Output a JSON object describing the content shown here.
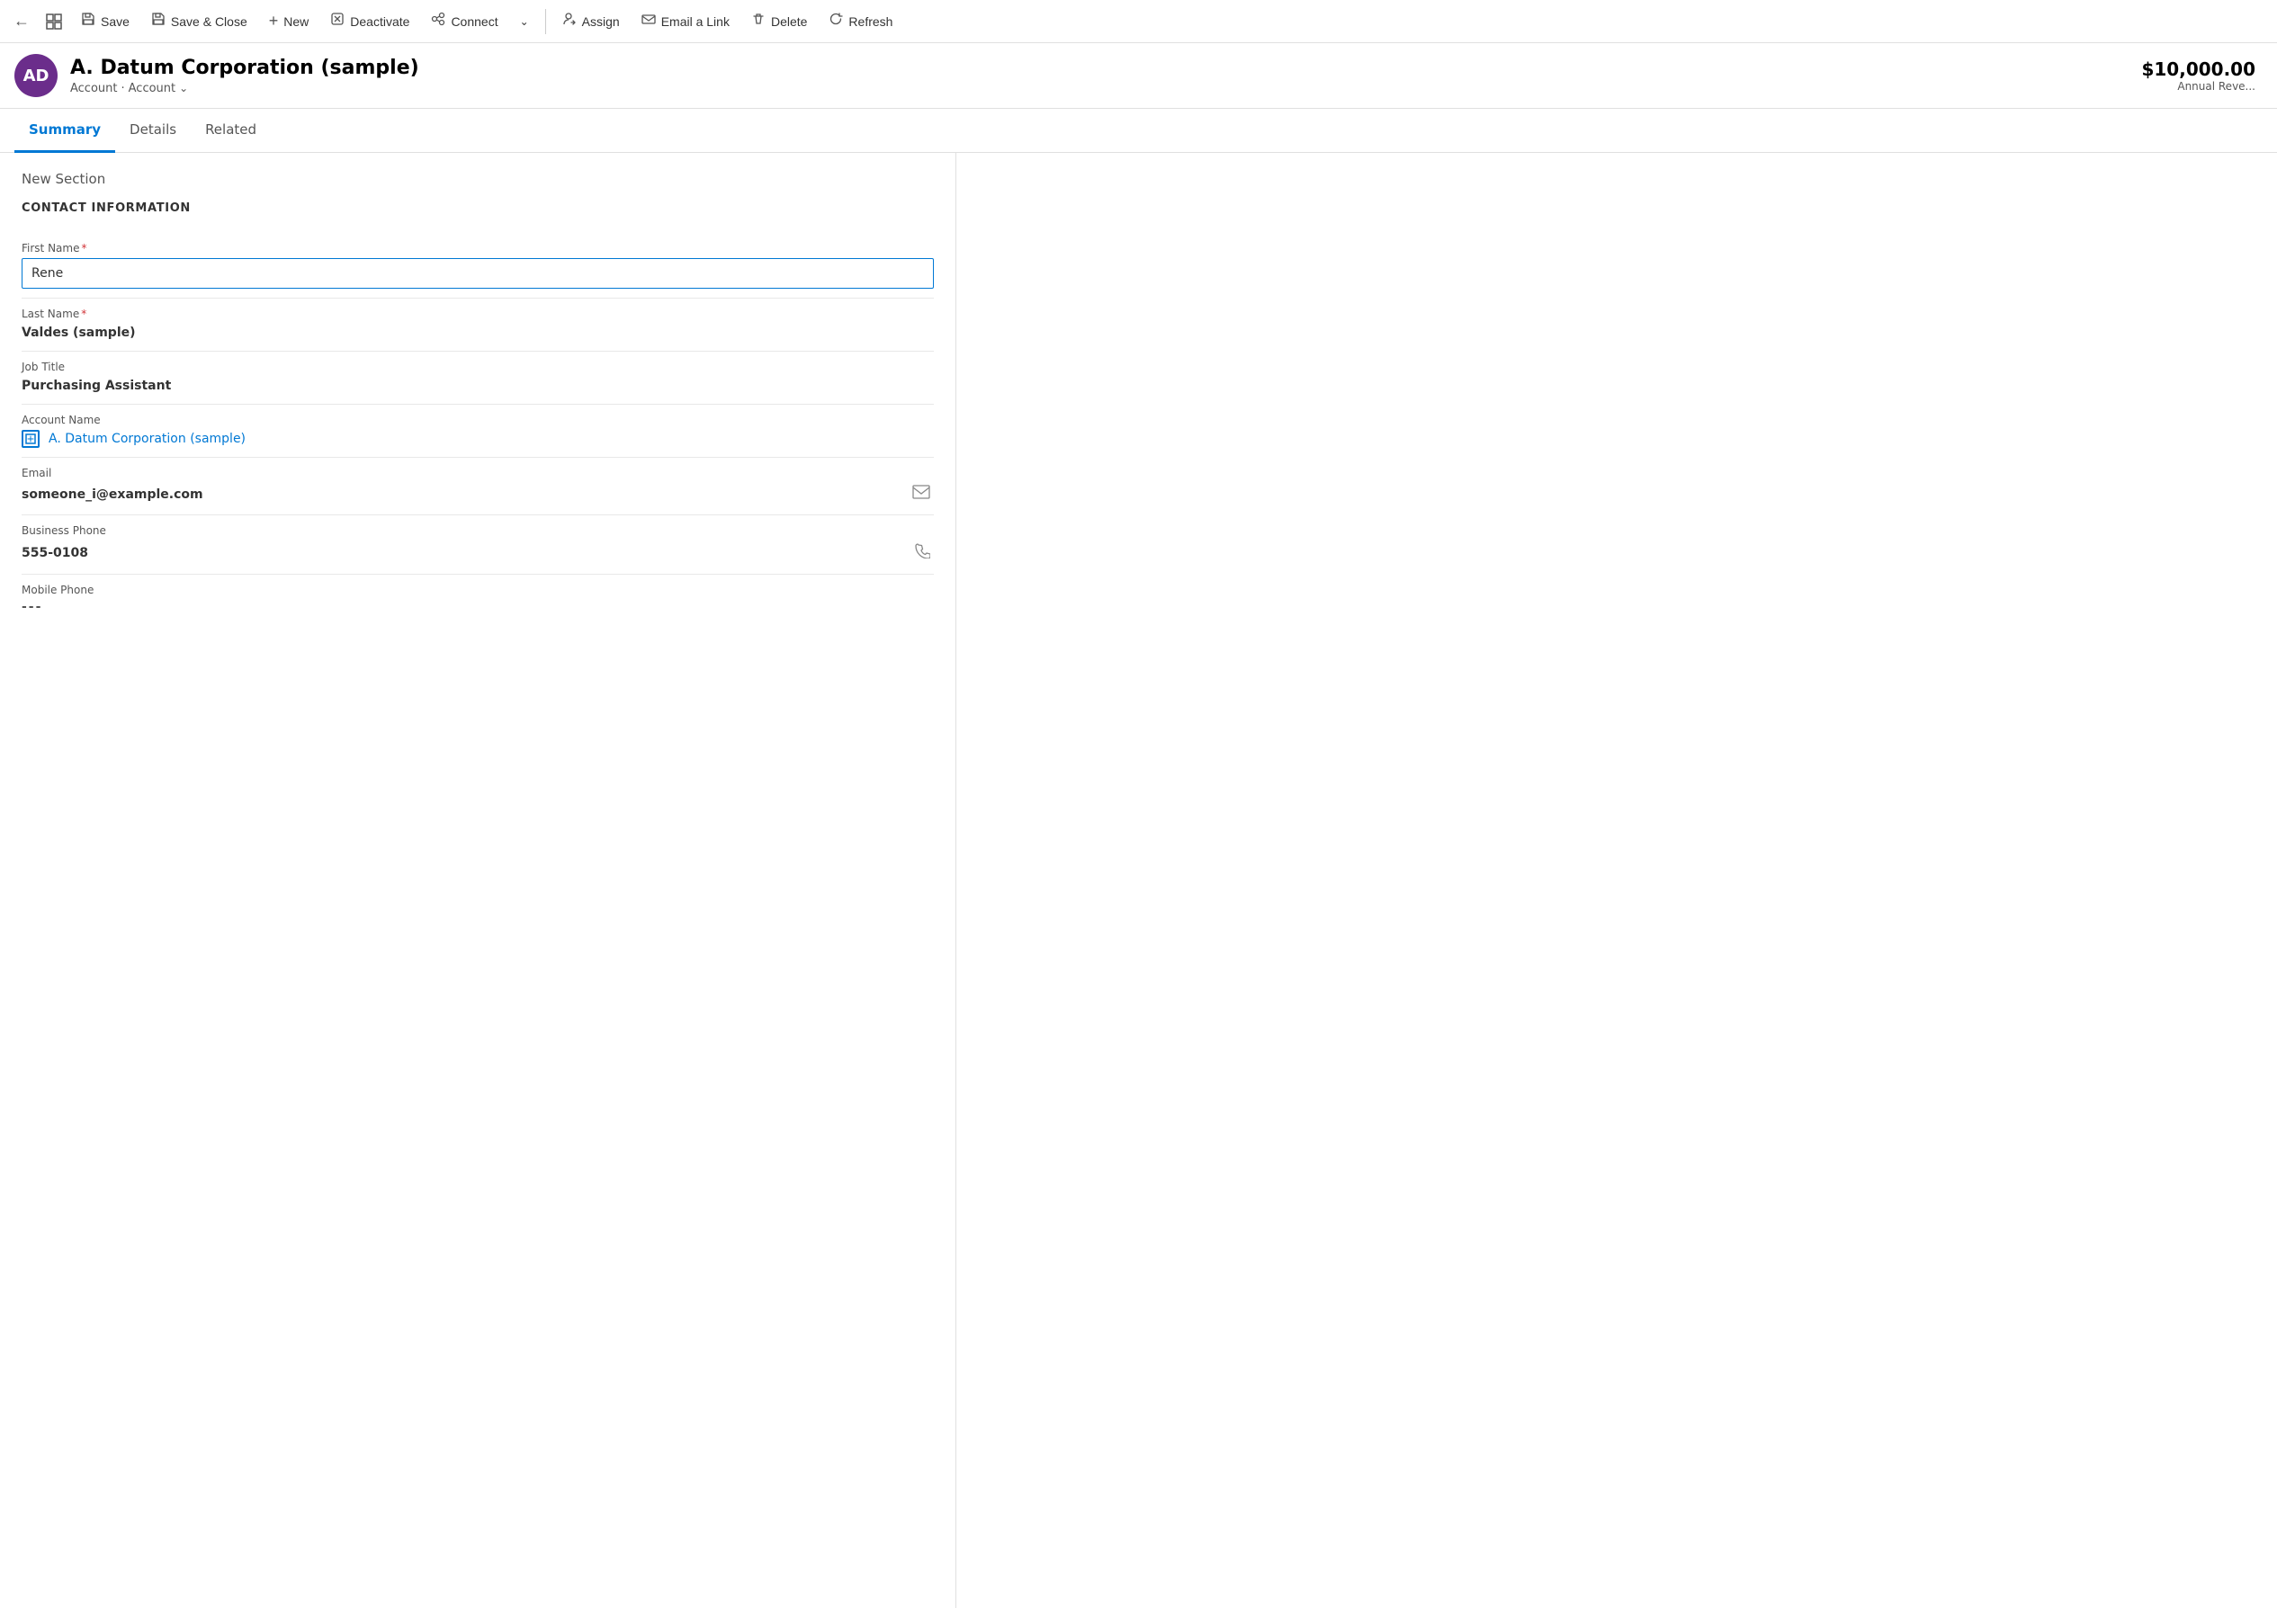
{
  "toolbar": {
    "back_label": "←",
    "form_icon_label": "⊞",
    "save_label": "Save",
    "save_close_label": "Save & Close",
    "new_label": "New",
    "deactivate_label": "Deactivate",
    "connect_label": "Connect",
    "more_label": "∨",
    "assign_label": "Assign",
    "email_link_label": "Email a Link",
    "delete_label": "Delete",
    "refresh_label": "Refresh"
  },
  "record": {
    "avatar_initials": "AD",
    "title": "A. Datum Corporation (sample)",
    "breadcrumb_type": "Account",
    "breadcrumb_view": "Account",
    "annual_revenue": "$10,000.00",
    "annual_revenue_label": "Annual Reve..."
  },
  "tabs": [
    {
      "id": "summary",
      "label": "Summary",
      "active": true
    },
    {
      "id": "details",
      "label": "Details",
      "active": false
    },
    {
      "id": "related",
      "label": "Related",
      "active": false
    }
  ],
  "form": {
    "section_title": "New Section",
    "section_header": "CONTACT INFORMATION",
    "fields": [
      {
        "id": "first_name",
        "label": "First Name",
        "required": true,
        "type": "input",
        "value": "Rene"
      },
      {
        "id": "last_name",
        "label": "Last Name",
        "required": true,
        "type": "text",
        "value": "Valdes (sample)"
      },
      {
        "id": "job_title",
        "label": "Job Title",
        "required": false,
        "type": "text",
        "value": "Purchasing Assistant"
      },
      {
        "id": "account_name",
        "label": "Account Name",
        "required": false,
        "type": "link",
        "value": "A. Datum Corporation (sample)"
      },
      {
        "id": "email",
        "label": "Email",
        "required": false,
        "type": "text_icon",
        "value": "someone_i@example.com",
        "icon": "email"
      },
      {
        "id": "business_phone",
        "label": "Business Phone",
        "required": false,
        "type": "text_icon",
        "value": "555-0108",
        "icon": "phone"
      },
      {
        "id": "mobile_phone",
        "label": "Mobile Phone",
        "required": false,
        "type": "text",
        "value": "---"
      }
    ]
  }
}
